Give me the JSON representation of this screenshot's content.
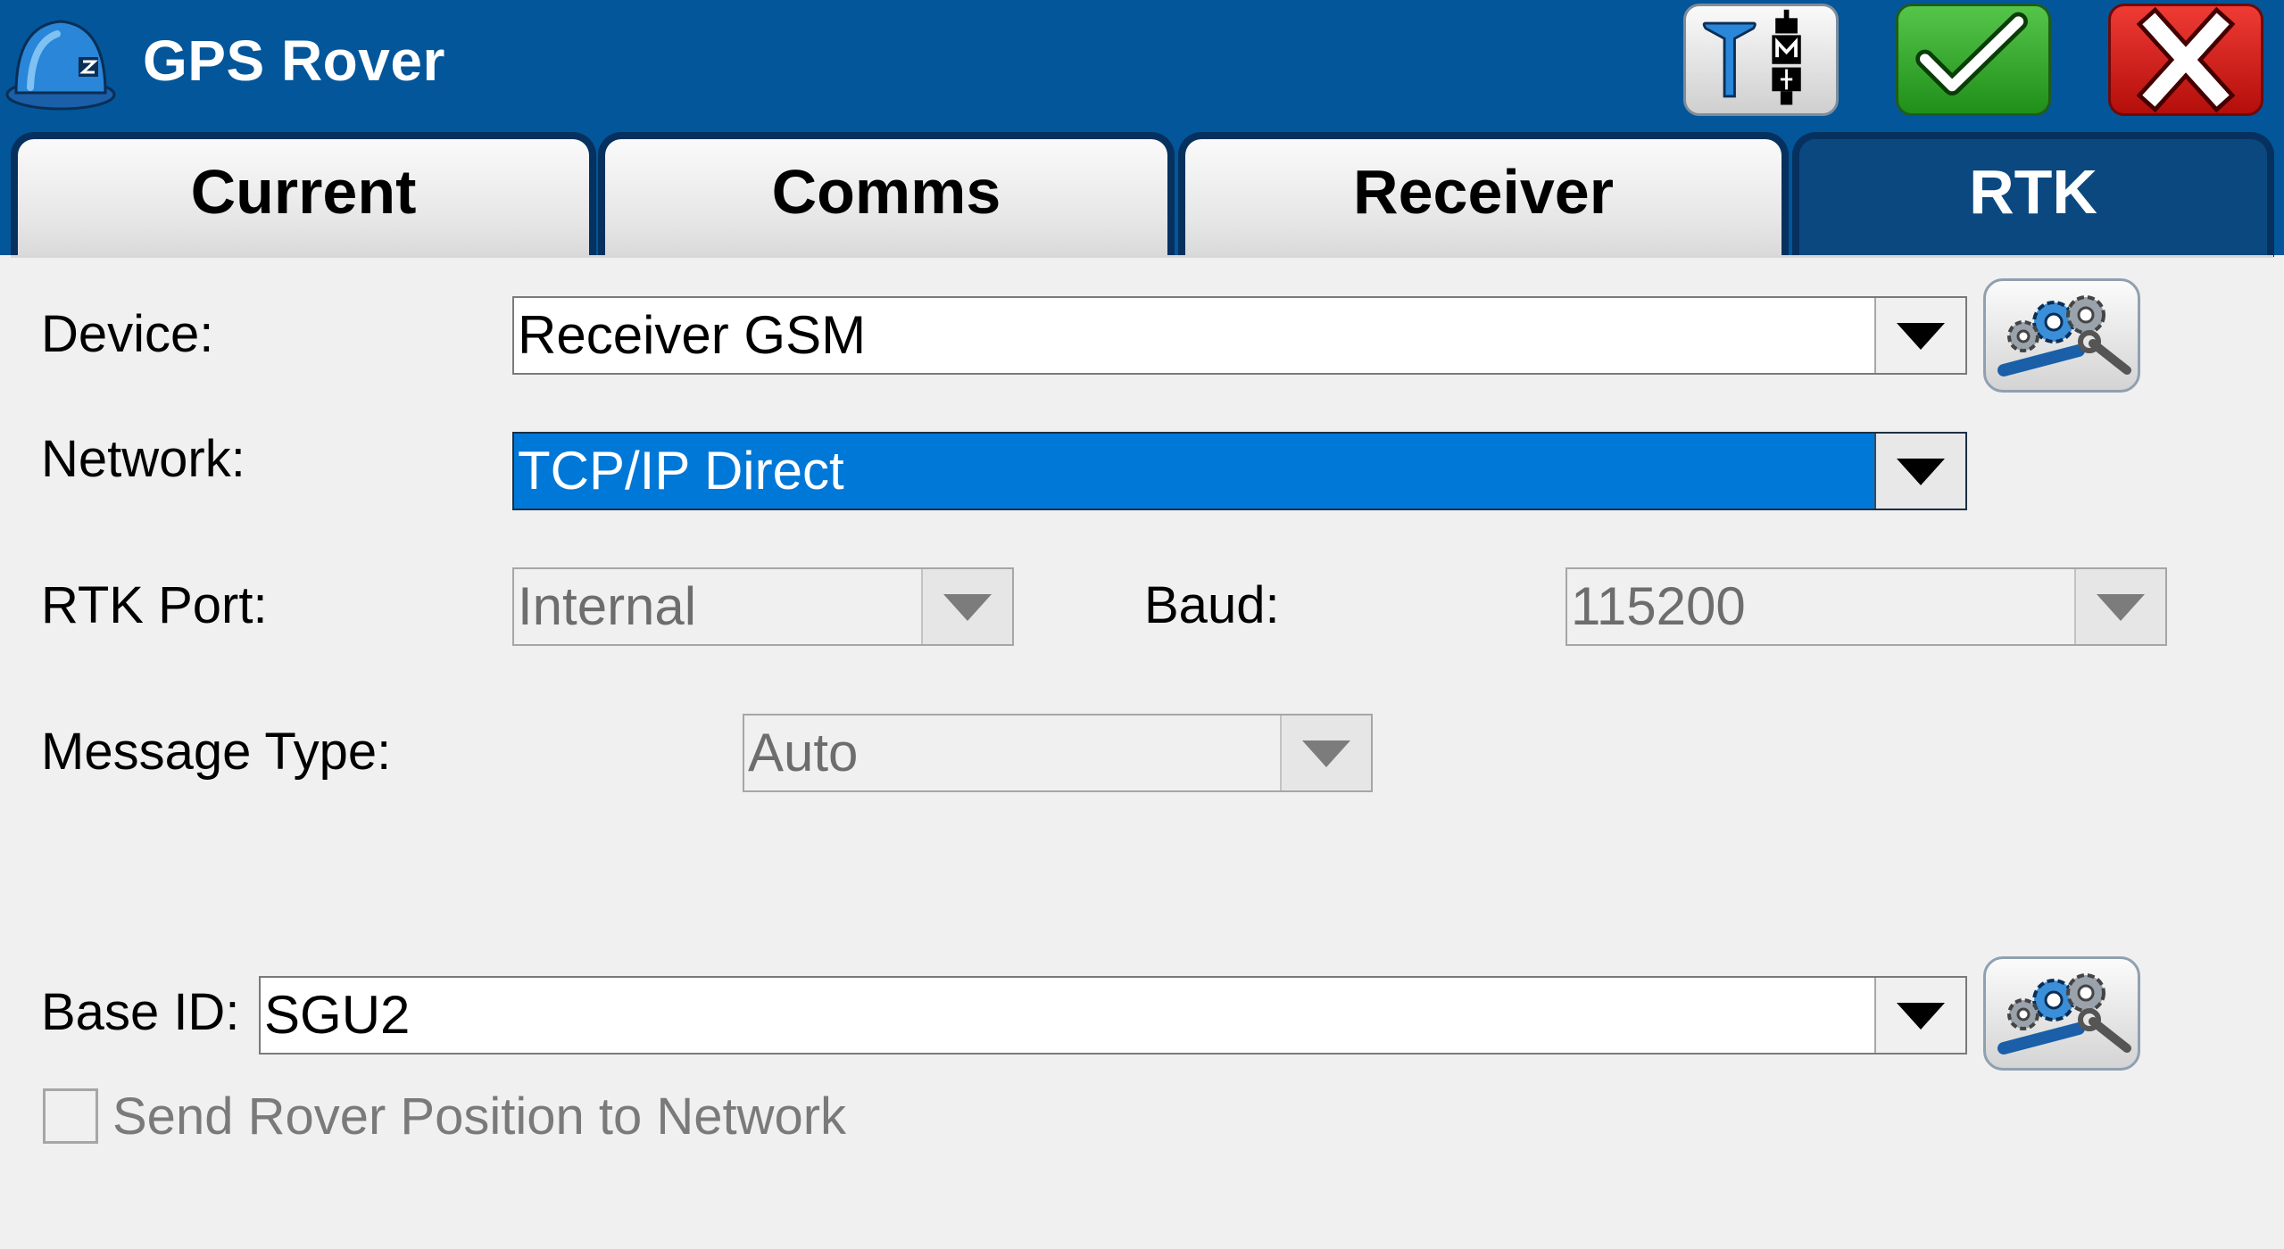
{
  "title_bar": {
    "title": "GPS Rover",
    "buttons": [
      "rover-config-icon",
      "checkmark-icon",
      "close-x-icon"
    ]
  },
  "tabs": [
    {
      "label": "Current",
      "active": false
    },
    {
      "label": "Comms",
      "active": false
    },
    {
      "label": "Receiver",
      "active": false
    },
    {
      "label": "RTK",
      "active": true
    }
  ],
  "form": {
    "device": {
      "label": "Device:",
      "value": "Receiver GSM"
    },
    "network": {
      "label": "Network:",
      "value": "TCP/IP Direct"
    },
    "rtk_port": {
      "label": "RTK Port:",
      "value": "Internal"
    },
    "baud": {
      "label": "Baud:",
      "value": "115200"
    },
    "message_type": {
      "label": "Message Type:",
      "value": "Auto"
    },
    "base_id": {
      "label": "Base ID:",
      "value": "SGU2"
    },
    "send_rover_position": {
      "label": "Send Rover Position to Network",
      "checked": false
    }
  },
  "colors": {
    "title_bar": "#03569a",
    "active_tab": "#0b4880",
    "selection": "#0078d7",
    "ok_button": "#2b9c25",
    "cancel_button": "#d61a14"
  }
}
